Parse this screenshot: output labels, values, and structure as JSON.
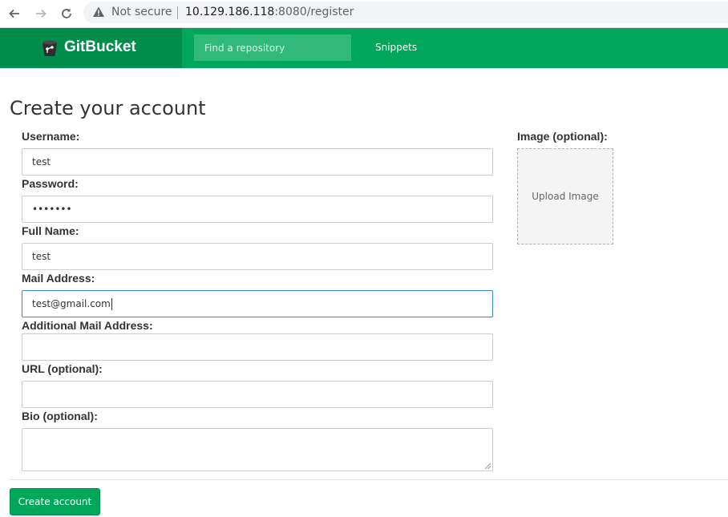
{
  "browser": {
    "security_label": "Not secure",
    "url_host": "10.129.186.118",
    "url_rest": ":8080/register",
    "icons": [
      "back-arrow-icon",
      "forward-arrow-icon",
      "reload-icon",
      "warning-icon"
    ]
  },
  "header": {
    "brand": "GitBucket",
    "search_placeholder": "Find a repository",
    "nav_snippets": "Snippets",
    "colors": {
      "header": "#00a65a",
      "brand_bg": "#008d4c"
    }
  },
  "form": {
    "title": "Create your account",
    "username_label": "Username:",
    "username_value": "test",
    "password_label": "Password:",
    "password_value": "•••••••",
    "fullname_label": "Full Name:",
    "fullname_value": "test",
    "mail_label": "Mail Address:",
    "mail_value": "test@gmail.com",
    "extra_mail_label": "Additional Mail Address:",
    "extra_mail_value": "",
    "url_label": "URL (optional):",
    "url_value": "",
    "bio_label": "Bio (optional):",
    "bio_value": "",
    "image_label": "Image (optional):",
    "upload_label": "Upload Image",
    "submit_label": "Create account"
  }
}
